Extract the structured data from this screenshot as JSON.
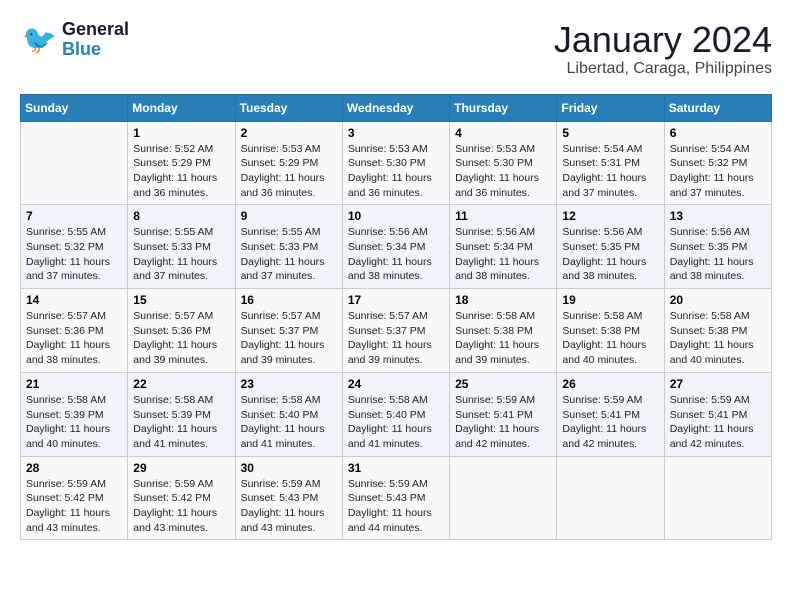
{
  "header": {
    "logo_general": "General",
    "logo_blue": "Blue",
    "month_title": "January 2024",
    "location": "Libertad, Caraga, Philippines"
  },
  "days_of_week": [
    "Sunday",
    "Monday",
    "Tuesday",
    "Wednesday",
    "Thursday",
    "Friday",
    "Saturday"
  ],
  "weeks": [
    [
      {
        "day": "",
        "content": ""
      },
      {
        "day": "1",
        "content": "Sunrise: 5:52 AM\nSunset: 5:29 PM\nDaylight: 11 hours\nand 36 minutes."
      },
      {
        "day": "2",
        "content": "Sunrise: 5:53 AM\nSunset: 5:29 PM\nDaylight: 11 hours\nand 36 minutes."
      },
      {
        "day": "3",
        "content": "Sunrise: 5:53 AM\nSunset: 5:30 PM\nDaylight: 11 hours\nand 36 minutes."
      },
      {
        "day": "4",
        "content": "Sunrise: 5:53 AM\nSunset: 5:30 PM\nDaylight: 11 hours\nand 36 minutes."
      },
      {
        "day": "5",
        "content": "Sunrise: 5:54 AM\nSunset: 5:31 PM\nDaylight: 11 hours\nand 37 minutes."
      },
      {
        "day": "6",
        "content": "Sunrise: 5:54 AM\nSunset: 5:32 PM\nDaylight: 11 hours\nand 37 minutes."
      }
    ],
    [
      {
        "day": "7",
        "content": "Sunrise: 5:55 AM\nSunset: 5:32 PM\nDaylight: 11 hours\nand 37 minutes."
      },
      {
        "day": "8",
        "content": "Sunrise: 5:55 AM\nSunset: 5:33 PM\nDaylight: 11 hours\nand 37 minutes."
      },
      {
        "day": "9",
        "content": "Sunrise: 5:55 AM\nSunset: 5:33 PM\nDaylight: 11 hours\nand 37 minutes."
      },
      {
        "day": "10",
        "content": "Sunrise: 5:56 AM\nSunset: 5:34 PM\nDaylight: 11 hours\nand 38 minutes."
      },
      {
        "day": "11",
        "content": "Sunrise: 5:56 AM\nSunset: 5:34 PM\nDaylight: 11 hours\nand 38 minutes."
      },
      {
        "day": "12",
        "content": "Sunrise: 5:56 AM\nSunset: 5:35 PM\nDaylight: 11 hours\nand 38 minutes."
      },
      {
        "day": "13",
        "content": "Sunrise: 5:56 AM\nSunset: 5:35 PM\nDaylight: 11 hours\nand 38 minutes."
      }
    ],
    [
      {
        "day": "14",
        "content": "Sunrise: 5:57 AM\nSunset: 5:36 PM\nDaylight: 11 hours\nand 38 minutes."
      },
      {
        "day": "15",
        "content": "Sunrise: 5:57 AM\nSunset: 5:36 PM\nDaylight: 11 hours\nand 39 minutes."
      },
      {
        "day": "16",
        "content": "Sunrise: 5:57 AM\nSunset: 5:37 PM\nDaylight: 11 hours\nand 39 minutes."
      },
      {
        "day": "17",
        "content": "Sunrise: 5:57 AM\nSunset: 5:37 PM\nDaylight: 11 hours\nand 39 minutes."
      },
      {
        "day": "18",
        "content": "Sunrise: 5:58 AM\nSunset: 5:38 PM\nDaylight: 11 hours\nand 39 minutes."
      },
      {
        "day": "19",
        "content": "Sunrise: 5:58 AM\nSunset: 5:38 PM\nDaylight: 11 hours\nand 40 minutes."
      },
      {
        "day": "20",
        "content": "Sunrise: 5:58 AM\nSunset: 5:38 PM\nDaylight: 11 hours\nand 40 minutes."
      }
    ],
    [
      {
        "day": "21",
        "content": "Sunrise: 5:58 AM\nSunset: 5:39 PM\nDaylight: 11 hours\nand 40 minutes."
      },
      {
        "day": "22",
        "content": "Sunrise: 5:58 AM\nSunset: 5:39 PM\nDaylight: 11 hours\nand 41 minutes."
      },
      {
        "day": "23",
        "content": "Sunrise: 5:58 AM\nSunset: 5:40 PM\nDaylight: 11 hours\nand 41 minutes."
      },
      {
        "day": "24",
        "content": "Sunrise: 5:58 AM\nSunset: 5:40 PM\nDaylight: 11 hours\nand 41 minutes."
      },
      {
        "day": "25",
        "content": "Sunrise: 5:59 AM\nSunset: 5:41 PM\nDaylight: 11 hours\nand 42 minutes."
      },
      {
        "day": "26",
        "content": "Sunrise: 5:59 AM\nSunset: 5:41 PM\nDaylight: 11 hours\nand 42 minutes."
      },
      {
        "day": "27",
        "content": "Sunrise: 5:59 AM\nSunset: 5:41 PM\nDaylight: 11 hours\nand 42 minutes."
      }
    ],
    [
      {
        "day": "28",
        "content": "Sunrise: 5:59 AM\nSunset: 5:42 PM\nDaylight: 11 hours\nand 43 minutes."
      },
      {
        "day": "29",
        "content": "Sunrise: 5:59 AM\nSunset: 5:42 PM\nDaylight: 11 hours\nand 43 minutes."
      },
      {
        "day": "30",
        "content": "Sunrise: 5:59 AM\nSunset: 5:43 PM\nDaylight: 11 hours\nand 43 minutes."
      },
      {
        "day": "31",
        "content": "Sunrise: 5:59 AM\nSunset: 5:43 PM\nDaylight: 11 hours\nand 44 minutes."
      },
      {
        "day": "",
        "content": ""
      },
      {
        "day": "",
        "content": ""
      },
      {
        "day": "",
        "content": ""
      }
    ]
  ]
}
